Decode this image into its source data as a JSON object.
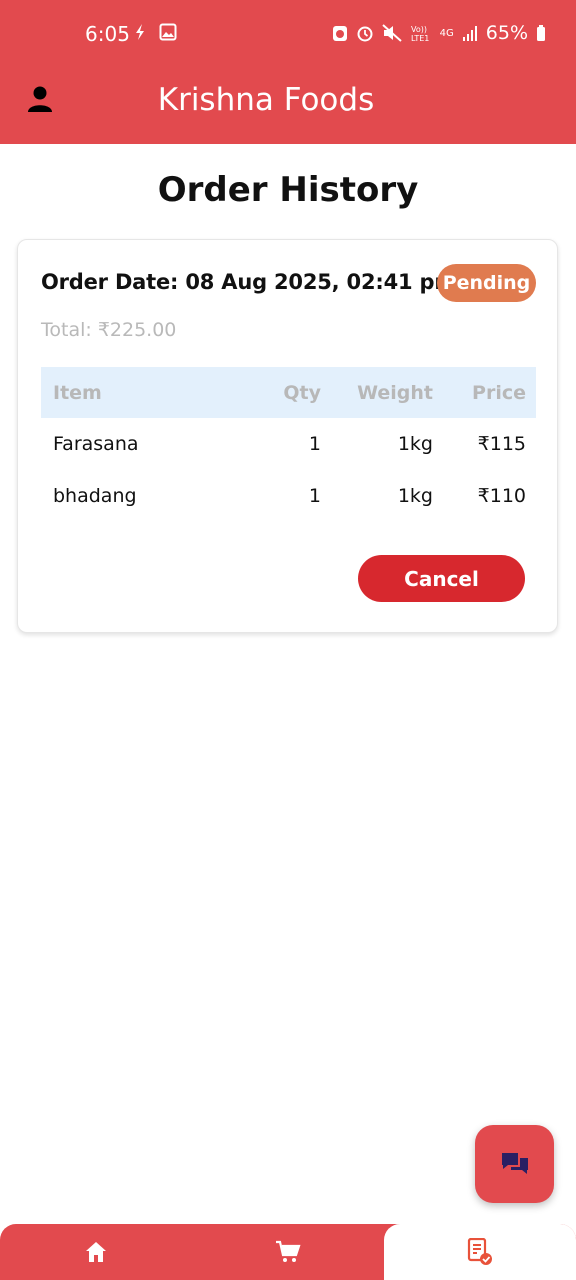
{
  "status_bar": {
    "time": "6:05",
    "battery": "65%",
    "network": "4G"
  },
  "app_bar": {
    "title": "Krishna Foods"
  },
  "page": {
    "title": "Order History"
  },
  "order": {
    "date_text": "Order Date: 08 Aug 2025, 02:41 pm",
    "status": "Pending",
    "total_text": "Total: ₹225.00",
    "columns": [
      "Item",
      "Qty",
      "Weight",
      "Price"
    ],
    "items": [
      {
        "item": "Farasana",
        "qty": "1",
        "weight": "1kg",
        "price": "₹115"
      },
      {
        "item": "bhadang",
        "qty": "1",
        "weight": "1kg",
        "price": "₹110"
      }
    ],
    "cancel_label": "Cancel"
  },
  "bottom_nav": {
    "items": [
      {
        "icon": "home-icon",
        "active": false
      },
      {
        "icon": "cart-icon",
        "active": false
      },
      {
        "icon": "orders-icon",
        "active": true
      }
    ]
  },
  "colors": {
    "primary": "#e24a4e",
    "pending_badge": "#e07b4f",
    "cancel_button": "#d7282e",
    "table_header_bg": "#e3f0fc"
  }
}
